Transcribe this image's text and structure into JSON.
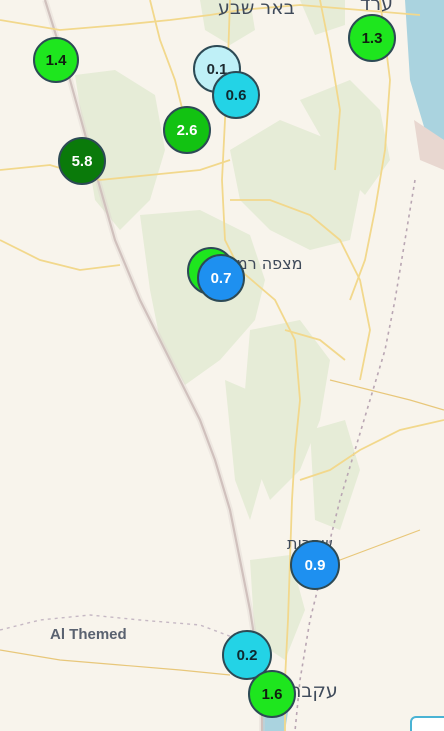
{
  "map": {
    "cities": [
      {
        "name": "באר שבע",
        "id": "beersheba"
      },
      {
        "name": "ערד",
        "id": "arad"
      },
      {
        "name": "מצפה רמון",
        "id": "mitzpe-ramon"
      },
      {
        "name": "שחרות",
        "id": "shaharut"
      },
      {
        "name": "עקבה",
        "id": "aqaba"
      }
    ],
    "places": [
      {
        "name": "Al Themed"
      }
    ]
  },
  "markers": [
    {
      "value": "1.4",
      "color": "#1ee61e"
    },
    {
      "value": "1.3",
      "color": "#1ee61e"
    },
    {
      "value": "0.1",
      "color": "#bff0f7"
    },
    {
      "value": "0.6",
      "color": "#23d3e6"
    },
    {
      "value": "2.6",
      "color": "#12c212"
    },
    {
      "value": "5.8",
      "color": "#0a7a0a"
    },
    {
      "value": "",
      "color": "#1ee61e"
    },
    {
      "value": "0.7",
      "color": "#1e90f0"
    },
    {
      "value": "0.9",
      "color": "#1e90f0"
    },
    {
      "value": "0.2",
      "color": "#23d3e6"
    },
    {
      "value": "1.6",
      "color": "#1ee61e"
    }
  ]
}
